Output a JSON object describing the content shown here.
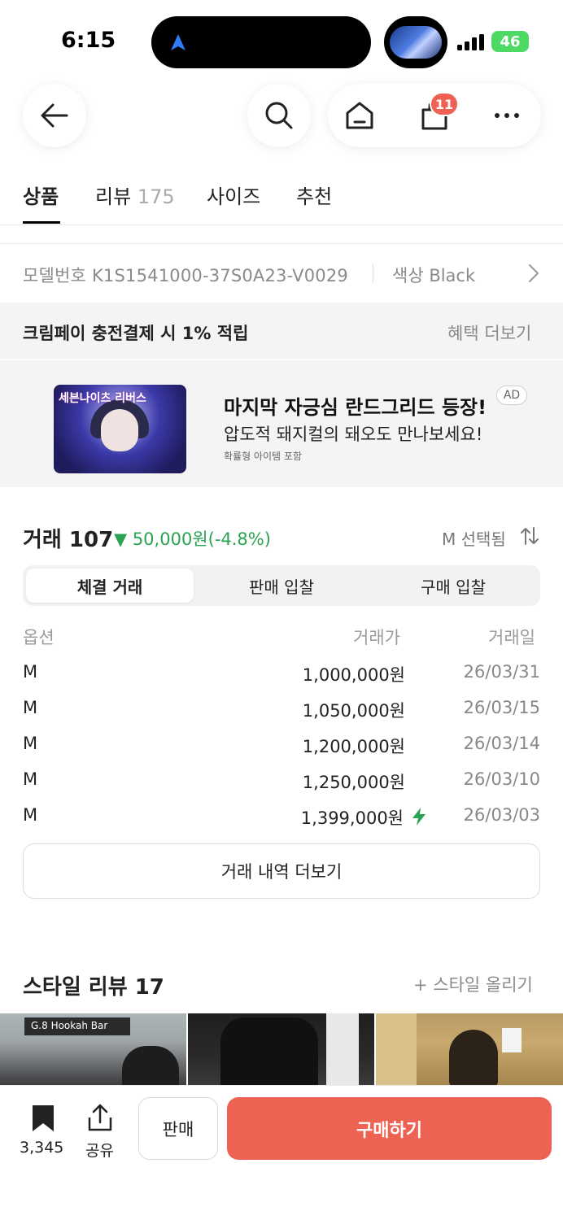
{
  "status_bar": {
    "time": "6:15",
    "battery": "46"
  },
  "header": {
    "icons": [
      "back-arrow-icon",
      "search-icon",
      "home-icon",
      "shopping-bag-icon",
      "more-icon"
    ],
    "cart_badge": "11"
  },
  "tabs": [
    {
      "label": "상품",
      "count": ""
    },
    {
      "label": "리뷰",
      "count": "175"
    },
    {
      "label": "사이즈",
      "count": ""
    },
    {
      "label": "추천",
      "count": ""
    }
  ],
  "product_info": {
    "model_number": "모델번호 K1S1541000-37S0A23-V0029",
    "color": "색상 Black"
  },
  "cream_pay": {
    "text": "크림페이 충전결제 시 1% 적립",
    "more": "혜택 더보기"
  },
  "ad": {
    "title": "마지막 자긍심 란드그리드 등장!",
    "subtitle": "압도적 돼지컬의 돼오도 만나보세요!",
    "note": "확률형 아이템 포함",
    "tag": "AD",
    "image_logo": "세븐나이츠 리버스"
  },
  "trade": {
    "title": "거래 107",
    "change": "▼ 50,000원(-4.8%)",
    "selected": "M 선택됨",
    "segments": [
      "체결 거래",
      "판매 입찰",
      "구매 입찰"
    ],
    "columns": {
      "option": "옵션",
      "price": "거래가",
      "date": "거래일"
    },
    "rows": [
      {
        "option": "M",
        "price": "1,000,000원",
        "date": "26/03/31",
        "quick": false
      },
      {
        "option": "M",
        "price": "1,050,000원",
        "date": "26/03/15",
        "quick": false
      },
      {
        "option": "M",
        "price": "1,200,000원",
        "date": "26/03/14",
        "quick": false
      },
      {
        "option": "M",
        "price": "1,250,000원",
        "date": "26/03/10",
        "quick": false
      },
      {
        "option": "M",
        "price": "1,399,000원",
        "date": "26/03/03",
        "quick": true
      }
    ],
    "more_button": "거래 내역 더보기",
    "accent_green": "#2aa352"
  },
  "style_review": {
    "title": "스타일 리뷰 17",
    "upload": "+ 스타일 올리기",
    "photo1_sign": "G.8 Hookah Bar"
  },
  "bottom_bar": {
    "bookmark_count": "3,345",
    "share_label": "공유",
    "sell_label": "판매",
    "buy_label": "구매하기",
    "accent": "#ee6253"
  }
}
